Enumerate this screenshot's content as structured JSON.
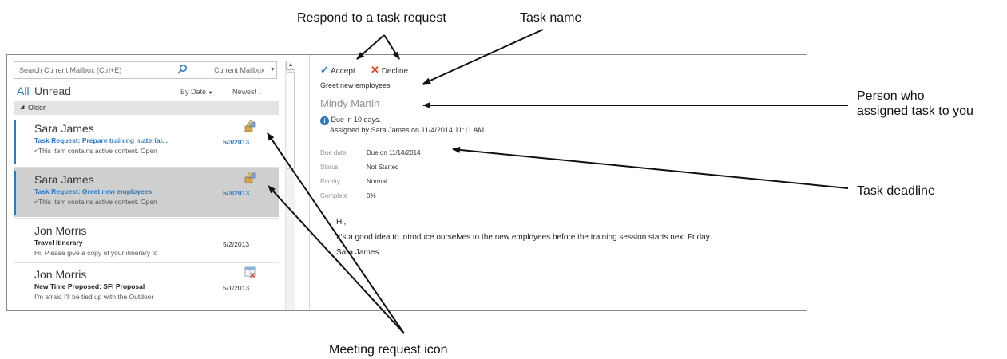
{
  "callouts": {
    "respond": "Respond to a task request",
    "task_name": "Task name",
    "person": "Person who",
    "person_line2": "assigned task to you",
    "deadline": "Task deadline",
    "meeting_icon": "Meeting request icon"
  },
  "search": {
    "placeholder": "Search Current Mailbox (Ctrl+E)",
    "scope": "Current Mailbox",
    "icon": "magnifier-icon"
  },
  "filters": {
    "all": "All",
    "unread": "Unread",
    "sort_by": "By Date",
    "order": "Newest"
  },
  "group": {
    "label": "Older"
  },
  "messages": [
    {
      "sender": "Sara James",
      "subject": "Task Request: Prepare training material...",
      "date": "5/3/2013",
      "preview": "<This item contains active content. Open",
      "icon": "task-request-icon",
      "unread": true,
      "selected": false
    },
    {
      "sender": "Sara James",
      "subject": "Task Request: Greet new employees",
      "date": "5/3/2013",
      "preview": "<This item contains active content. Open",
      "icon": "task-request-icon",
      "unread": true,
      "selected": true
    },
    {
      "sender": "Jon Morris",
      "subject": "Travel itinerary",
      "date": "5/2/2013",
      "preview": "Hi,   Please give a copy of your itinerary to",
      "icon": "",
      "unread": false,
      "selected": false
    },
    {
      "sender": "Jon Morris",
      "subject": "New Time Proposed: SFI Proposal",
      "date": "5/1/2013",
      "preview": "I'm afraid I'll be tied up with the Outdoor",
      "icon": "calendar-declined-icon",
      "unread": false,
      "selected": false
    }
  ],
  "reading": {
    "accept": "Accept",
    "decline": "Decline",
    "task_name": "Greet new employees",
    "assignee": "Mindy Martin",
    "due_info": "Due in 10 days.",
    "assigned_info": "Assigned by Sara James on 11/4/2014 11:11 AM.",
    "props": [
      {
        "label": "Due date",
        "value": "Due on 11/14/2014"
      },
      {
        "label": "Status",
        "value": "Not Started"
      },
      {
        "label": "Priority",
        "value": "Normal"
      },
      {
        "label": "Complete",
        "value": "0%"
      }
    ],
    "body": [
      "Hi,",
      "It's a good idea to introduce ourselves to the new employees before the training session starts next Friday.",
      "Sara James"
    ]
  },
  "colors": {
    "accent": "#2b79c2",
    "accept_check": "#2b79c2",
    "decline_x": "#e0451f",
    "selected_bg": "#cfcfcf"
  }
}
